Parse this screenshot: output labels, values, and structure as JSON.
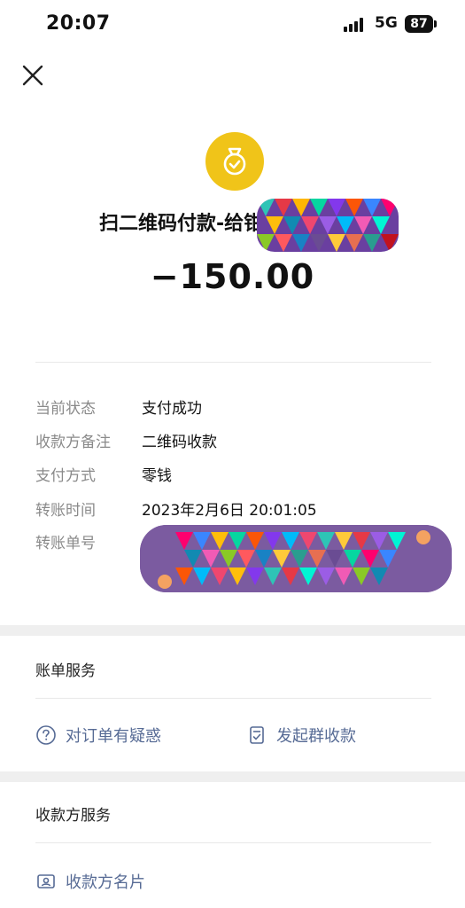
{
  "status_bar": {
    "time": "20:07",
    "network": "5G",
    "battery": "87"
  },
  "header": {
    "title": "扫二维码付款-给钳",
    "amount": "−150.00"
  },
  "details": [
    {
      "label": "当前状态",
      "value": "支付成功"
    },
    {
      "label": "收款方备注",
      "value": "二维码收款"
    },
    {
      "label": "支付方式",
      "value": "零钱"
    },
    {
      "label": "转账时间",
      "value": "2023年2月6日 20:01:05"
    },
    {
      "label": "转账单号",
      "value": ""
    }
  ],
  "bill_service": {
    "title": "账单服务",
    "question_label": "对订单有疑惑",
    "group_collect_label": "发起群收款"
  },
  "payee_service": {
    "title": "收款方服务",
    "card_label": "收款方名片"
  },
  "colors": {
    "accent_link": "#576b95",
    "bag_icon": "#f0c419",
    "muted_label": "#8a8a8a"
  }
}
